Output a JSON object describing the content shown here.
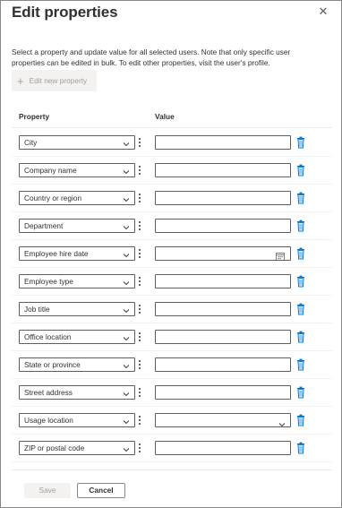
{
  "panel": {
    "title": "Edit properties",
    "close_icon": "close-icon",
    "description": "Select a property and update value for all selected users. Note that only specific user properties can be edited in bulk. To edit other properties, visit the user's profile.",
    "add_button_label": "Edit new property"
  },
  "table": {
    "property_header": "Property",
    "value_header": "Value",
    "rows": [
      {
        "property": "City",
        "value": "",
        "value_type": "text"
      },
      {
        "property": "Company name",
        "value": "",
        "value_type": "text"
      },
      {
        "property": "Country or region",
        "value": "",
        "value_type": "text"
      },
      {
        "property": "Department",
        "value": "",
        "value_type": "text"
      },
      {
        "property": "Employee hire date",
        "value": "",
        "value_type": "date"
      },
      {
        "property": "Employee type",
        "value": "",
        "value_type": "text"
      },
      {
        "property": "Job title",
        "value": "",
        "value_type": "text"
      },
      {
        "property": "Office location",
        "value": "",
        "value_type": "text"
      },
      {
        "property": "State or province",
        "value": "",
        "value_type": "text"
      },
      {
        "property": "Street address",
        "value": "",
        "value_type": "text"
      },
      {
        "property": "Usage location",
        "value": "",
        "value_type": "dropdown"
      },
      {
        "property": "ZIP or postal code",
        "value": "",
        "value_type": "text"
      }
    ]
  },
  "footer": {
    "save_label": "Save",
    "cancel_label": "Cancel"
  },
  "colors": {
    "accent": "#0078d4",
    "text": "#323130",
    "disabled_text": "#a19f9d",
    "border": "#605e5c"
  }
}
